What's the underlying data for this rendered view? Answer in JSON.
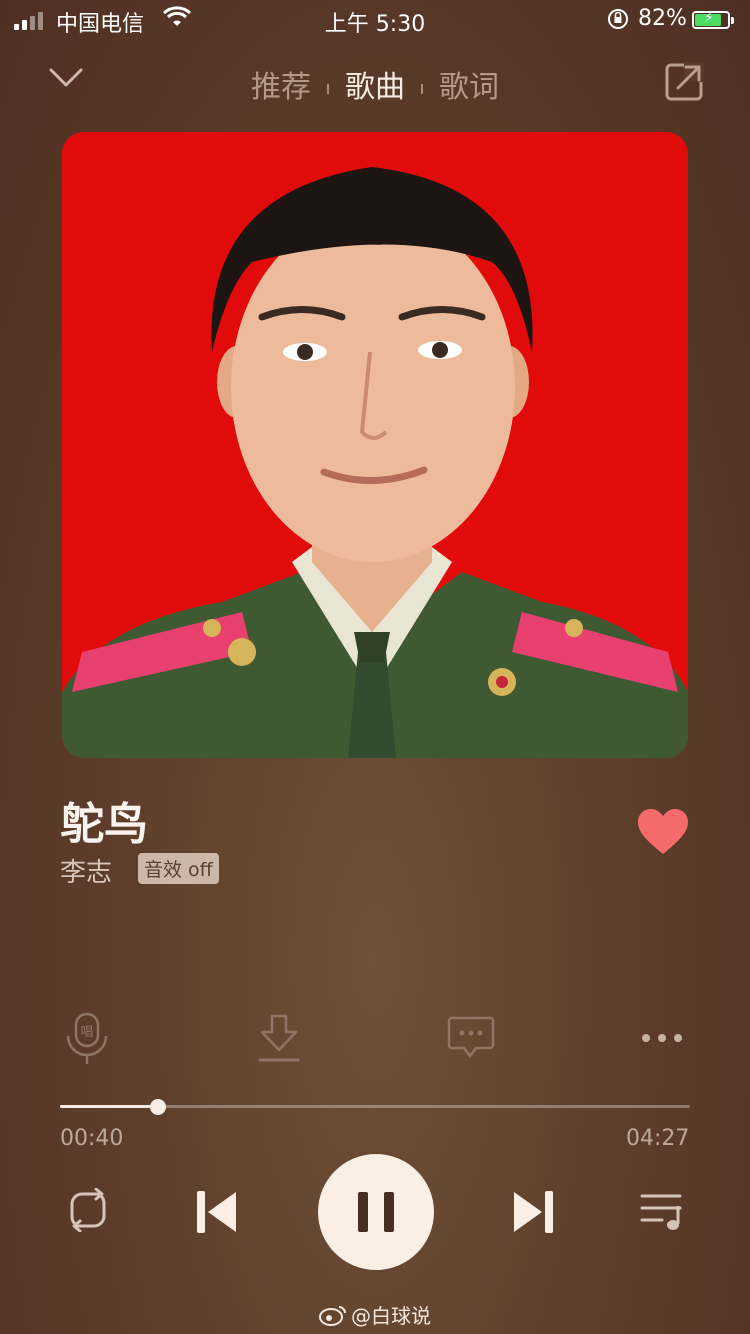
{
  "status": {
    "carrier": "中国电信",
    "time": "上午 5:30",
    "battery_pct": "82%",
    "battery_level": 0.82
  },
  "nav": {
    "tabs": [
      {
        "label": "推荐"
      },
      {
        "label": "歌曲"
      },
      {
        "label": "歌词"
      }
    ],
    "active_tab": "歌曲"
  },
  "song": {
    "title": "鸵鸟",
    "artist": "李志",
    "sound_effect": "音效 off",
    "liked": true
  },
  "player": {
    "current_time": "00:40",
    "total_time": "04:27",
    "progress": 0.155
  },
  "actions": {
    "sing_icon_text": "唱"
  },
  "watermark": {
    "text": "@白球说"
  },
  "colors": {
    "like": "#f56a6a",
    "cover_background": "#e20b0b",
    "accent": "#fbeee4"
  }
}
